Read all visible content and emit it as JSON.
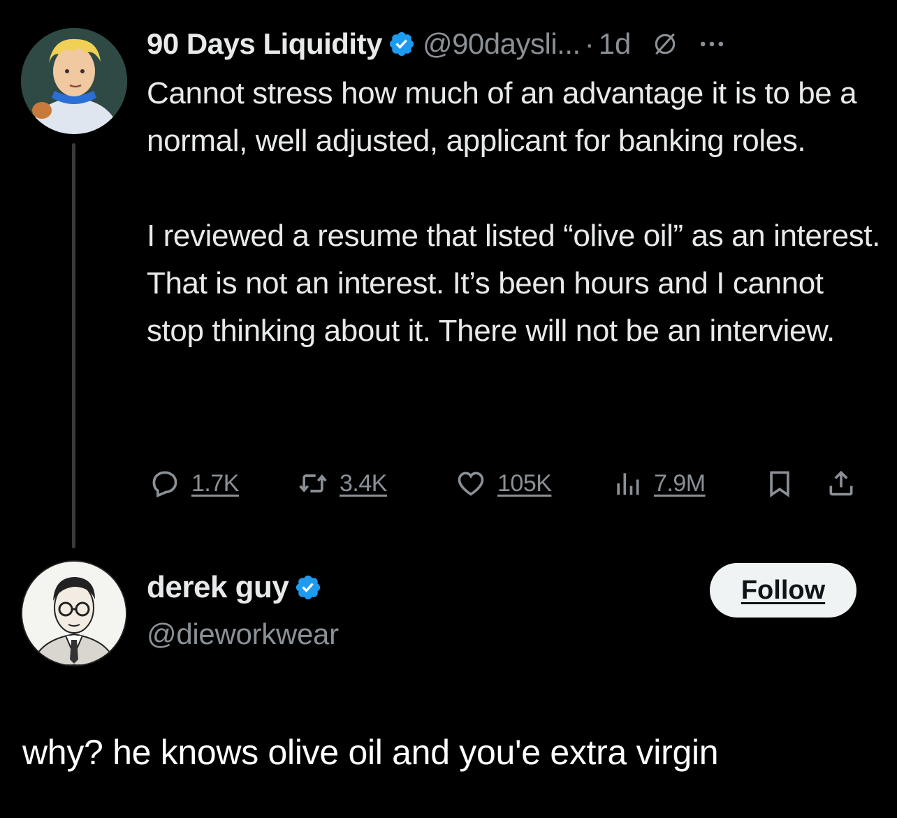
{
  "original_tweet": {
    "display_name": "90 Days Liquidity",
    "handle": "@90daysli...",
    "separator": "·",
    "time": "1d",
    "paragraphs": [
      "Cannot stress how much of an advantage it is to be a normal, well adjusted, applicant for banking roles.",
      "I reviewed a resume that listed “olive oil” as an interest. That is not an interest. It’s been hours and I cannot stop thinking about it. There will not be an interview."
    ],
    "metrics": {
      "replies": "1.7K",
      "retweets": "3.4K",
      "likes": "105K",
      "views": "7.9M"
    }
  },
  "reply_tweet": {
    "display_name": "derek guy",
    "handle": "@dieworkwear",
    "follow_label": "Follow"
  },
  "caption": "why? he knows olive oil and you'e extra virgin",
  "colors": {
    "background": "#000000",
    "text": "#e7e9ea",
    "secondary": "#8b9096",
    "verified": "#1d9bf0",
    "follow_bg": "#eff3f4"
  },
  "icons": [
    "verified-badge-icon",
    "grok-icon",
    "more-icon",
    "reply-icon",
    "retweet-icon",
    "like-icon",
    "views-icon",
    "bookmark-icon",
    "share-icon"
  ]
}
